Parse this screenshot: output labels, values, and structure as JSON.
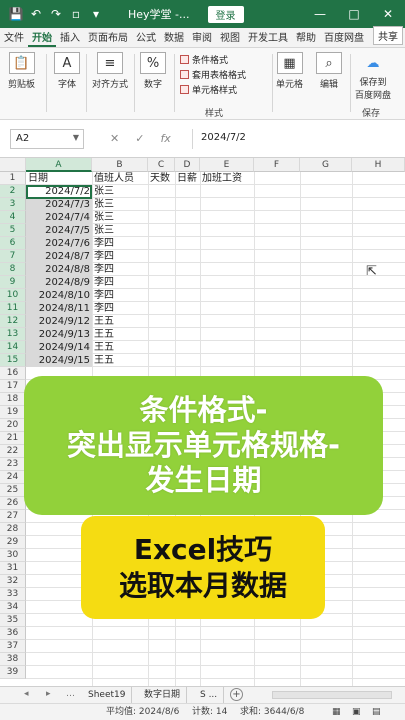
{
  "title_bar": {
    "document_name": "Hey学堂 -...",
    "login_label": "登录",
    "icons": [
      "save-icon",
      "undo-icon",
      "redo-icon",
      "page-setup-icon",
      "customize-icon"
    ],
    "window_buttons": [
      "—",
      "□",
      "✕"
    ]
  },
  "ribbon_tabs": [
    {
      "label": "文件",
      "active": false
    },
    {
      "label": "开始",
      "active": true
    },
    {
      "label": "插入",
      "active": false
    },
    {
      "label": "页面布局",
      "active": false
    },
    {
      "label": "公式",
      "active": false
    },
    {
      "label": "数据",
      "active": false
    },
    {
      "label": "审阅",
      "active": false
    },
    {
      "label": "视图",
      "active": false
    },
    {
      "label": "开发工具",
      "active": false
    },
    {
      "label": "帮助",
      "active": false
    },
    {
      "label": "百度网盘",
      "active": false
    }
  ],
  "share_label": "共享",
  "ribbon": {
    "clipboard": "剪贴板",
    "font": "字体",
    "alignment": "对齐方式",
    "number": "数字",
    "conditional_format": "条件格式",
    "table_format": "套用表格格式",
    "cell_styles": "单元格样式",
    "styles_group": "样式",
    "cells": "单元格",
    "editing": "编辑",
    "save_baidu_line1": "保存到",
    "save_baidu_line2": "百度网盘",
    "save_group": "保存"
  },
  "formula_bar": {
    "name_box": "A2",
    "fx_label": "fx",
    "value": "2024/7/2"
  },
  "columns": [
    "A",
    "B",
    "C",
    "D",
    "E",
    "F",
    "G",
    "H"
  ],
  "headers": {
    "A": "日期",
    "B": "值班人员",
    "C": "天数",
    "D": "日薪",
    "E": "加班工资"
  },
  "rows": [
    {
      "date": "2024/7/2",
      "name": "张三"
    },
    {
      "date": "2024/7/3",
      "name": "张三"
    },
    {
      "date": "2024/7/4",
      "name": "张三"
    },
    {
      "date": "2024/7/5",
      "name": "张三"
    },
    {
      "date": "2024/7/6",
      "name": "李四"
    },
    {
      "date": "2024/8/7",
      "name": "李四"
    },
    {
      "date": "2024/8/8",
      "name": "李四"
    },
    {
      "date": "2024/8/9",
      "name": "李四"
    },
    {
      "date": "2024/8/10",
      "name": "李四"
    },
    {
      "date": "2024/8/11",
      "name": "李四"
    },
    {
      "date": "2024/9/12",
      "name": "王五"
    },
    {
      "date": "2024/9/13",
      "name": "王五"
    },
    {
      "date": "2024/9/14",
      "name": "王五"
    },
    {
      "date": "2024/9/15",
      "name": "王五"
    }
  ],
  "row_numbers": [
    "1",
    "2",
    "3",
    "4",
    "5",
    "6",
    "7",
    "8",
    "9",
    "10",
    "11",
    "12",
    "13",
    "14",
    "15",
    "16",
    "17",
    "18",
    "19",
    "20",
    "21",
    "22",
    "23",
    "24",
    "25",
    "26",
    "27",
    "28",
    "29",
    "30",
    "31",
    "32",
    "33",
    "34",
    "35",
    "36",
    "37",
    "38",
    "39"
  ],
  "overlay": {
    "line1": "条件格式-",
    "line2": "突出显示单元格规格-",
    "line3": "发生日期",
    "sub1": "Excel技巧",
    "sub2": "选取本月数据",
    "green": "#92d13a",
    "yellow": "#f5dc12"
  },
  "sheet_tabs": [
    "Sheet19",
    "数字日期",
    "S ..."
  ],
  "status_bar": {
    "average": "平均值: 2024/8/6",
    "count": "计数: 14",
    "sum": "求和: 3644/6/8"
  },
  "accent_color": "#217346"
}
